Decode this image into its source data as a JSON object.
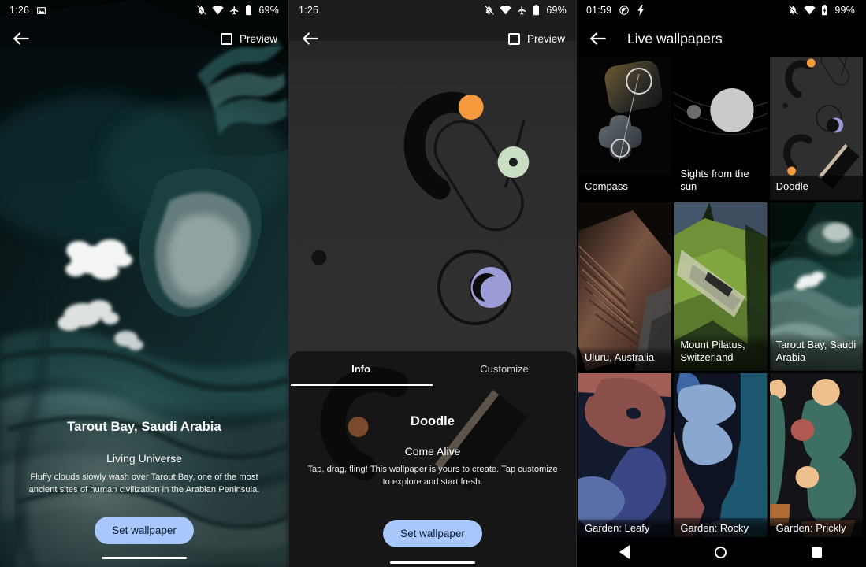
{
  "screen1": {
    "statusbar": {
      "clock": "1:26",
      "left_icons": [
        "image-icon"
      ],
      "right_icons": [
        "notifications-off-icon",
        "wifi-icon",
        "airplane-mode-icon",
        "battery-icon"
      ],
      "battery": "69%"
    },
    "toolbar": {
      "back_icon": "arrow-back-icon",
      "preview_label": "Preview",
      "preview_checkbox_icon": "checkbox-unchecked-icon"
    },
    "wallpaper_name": "tarout-bay-satellite-photo",
    "info": {
      "title": "Tarout Bay, Saudi Arabia",
      "collection": "Living Universe",
      "description": "Fluffy clouds slowly wash over Tarout Bay, one of the most ancient sites of human civilization in the Arabian Peninsula.",
      "set_wallpaper_label": "Set wallpaper"
    }
  },
  "screen2": {
    "statusbar": {
      "clock": "1:25",
      "right_icons": [
        "notifications-off-icon",
        "wifi-icon",
        "airplane-mode-icon",
        "battery-icon"
      ],
      "battery": "69%"
    },
    "toolbar": {
      "back_icon": "arrow-back-icon",
      "preview_label": "Preview",
      "preview_checkbox_icon": "checkbox-unchecked-icon"
    },
    "wallpaper_name": "doodle-live-wallpaper",
    "tabs": [
      {
        "label": "Info",
        "active": true
      },
      {
        "label": "Customize",
        "active": false
      }
    ],
    "info": {
      "title": "Doodle",
      "collection": "Come Alive",
      "description": "Tap, drag, fling! This wallpaper is yours to create. Tap customize to explore and start fresh.",
      "set_wallpaper_label": "Set wallpaper"
    }
  },
  "screen3": {
    "statusbar": {
      "clock": "01:59",
      "left_icons": [
        "location-off-icon",
        "charging-bolt-icon"
      ],
      "right_icons": [
        "notifications-off-icon",
        "wifi-icon",
        "battery-charging-icon"
      ],
      "battery": "99%"
    },
    "toolbar": {
      "back_icon": "arrow-back-icon",
      "title": "Live wallpapers"
    },
    "grid": [
      {
        "label": "Compass",
        "art": "compass-art"
      },
      {
        "label": "Sights from the sun",
        "art": "sun-art"
      },
      {
        "label": "Doodle",
        "art": "doodle-art"
      },
      {
        "label": "Uluru, Australia",
        "art": "uluru-photo"
      },
      {
        "label": "Mount Pilatus, Switzerland",
        "art": "pilatus-photo"
      },
      {
        "label": "Tarout Bay, Saudi Arabia",
        "art": "tarout-photo"
      },
      {
        "label": "Garden: Leafy",
        "art": "garden-leafy-art"
      },
      {
        "label": "Garden: Rocky",
        "art": "garden-rocky-art"
      },
      {
        "label": "Garden: Prickly",
        "art": "garden-prickly-art"
      }
    ],
    "navbar": {
      "back_icon": "nav-back-icon",
      "home_icon": "nav-home-icon",
      "recents_icon": "nav-recents-icon"
    }
  },
  "colors": {
    "accent_button": "#a8c7fa",
    "button_text": "#0b1a33",
    "sheet_bg": "#161616",
    "doodle_orange": "#f5993d",
    "doodle_purple": "#9b9bd6",
    "doodle_green": "#c9ddc2"
  }
}
